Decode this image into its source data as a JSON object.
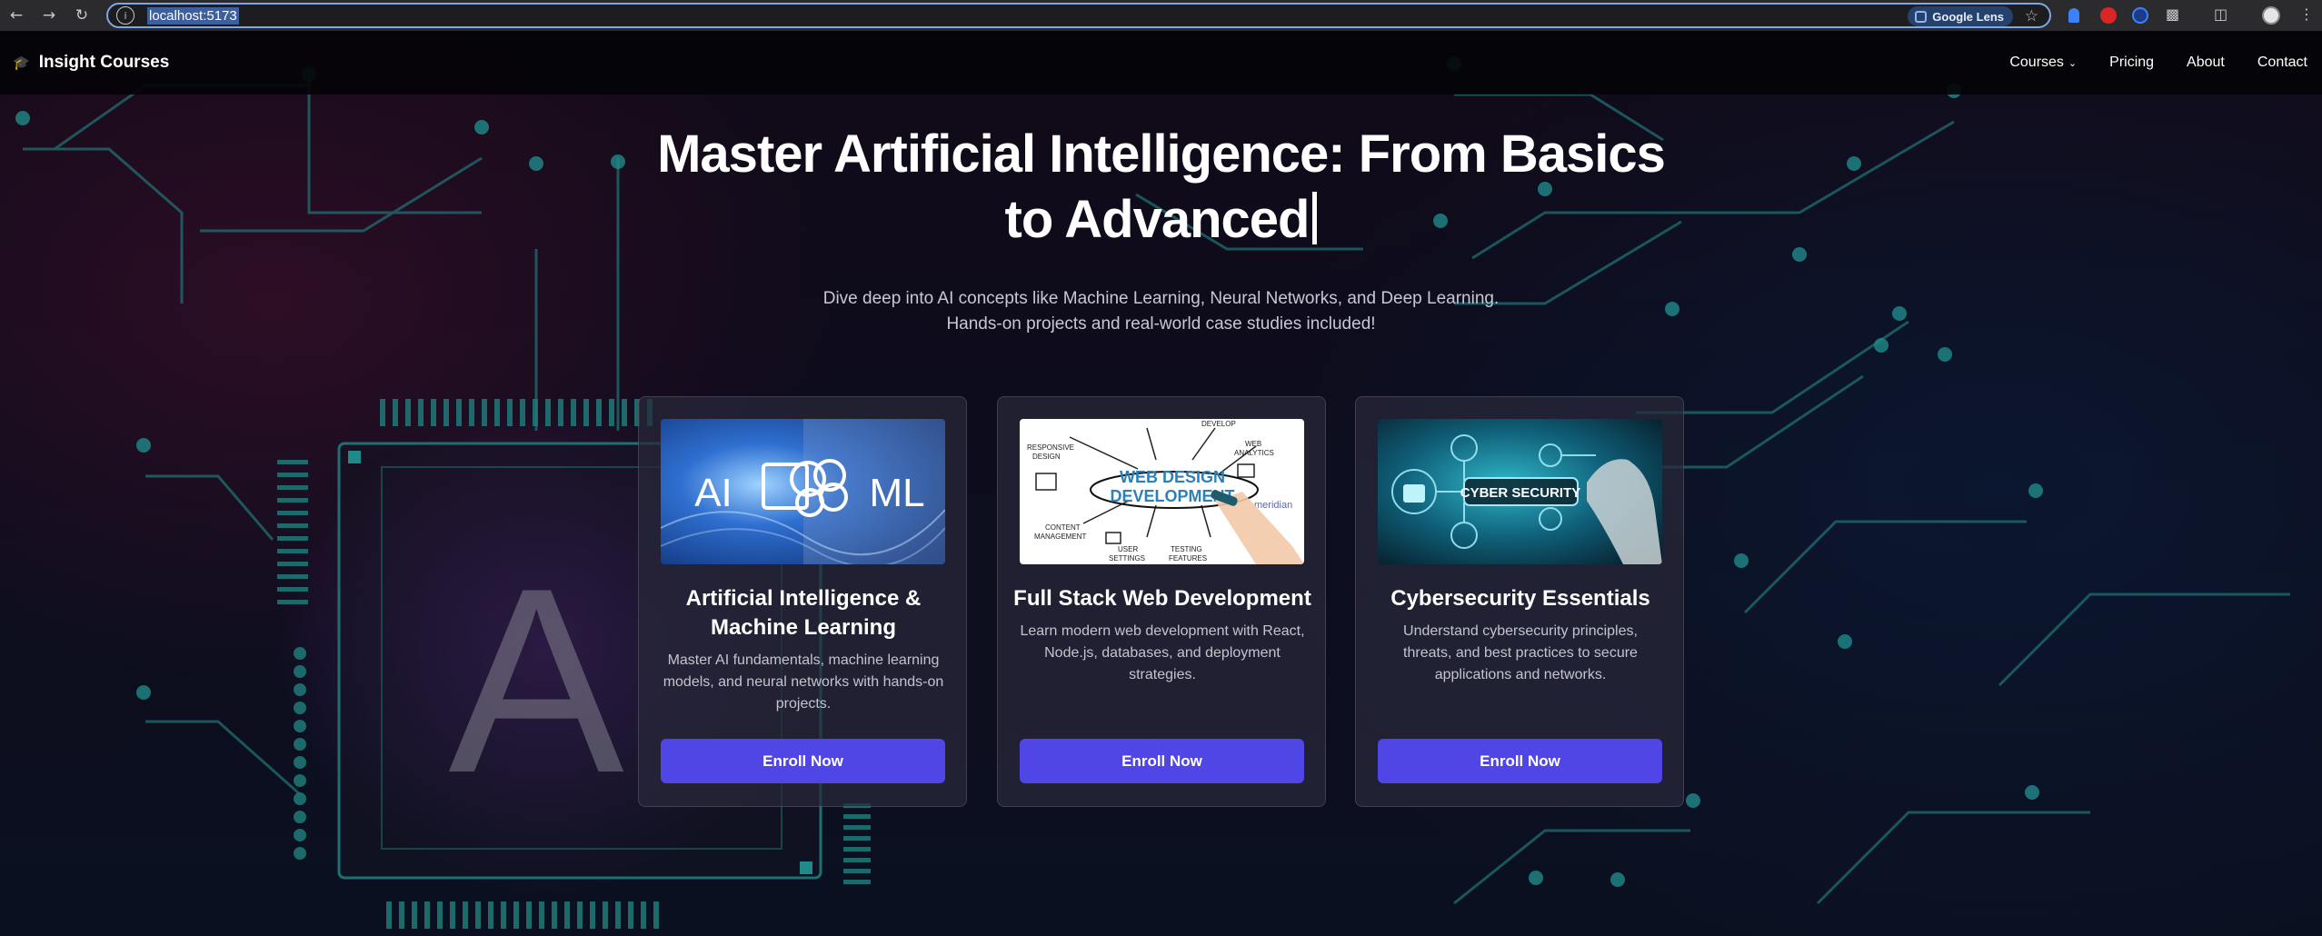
{
  "browser": {
    "url": "localhost:5173",
    "lens_label": "Google Lens"
  },
  "header": {
    "brand": "Insight Courses",
    "nav": {
      "courses": "Courses",
      "pricing": "Pricing",
      "about": "About",
      "contact": "Contact"
    }
  },
  "hero": {
    "title_line1": "Master Artificial Intelligence: From Basics",
    "title_line2": "to Advanced",
    "subtitle_line1": "Dive deep into AI concepts like Machine Learning, Neural Networks, and Deep Learning.",
    "subtitle_line2": "Hands-on projects and real-world case studies included!"
  },
  "background": {
    "big_letter": "A"
  },
  "cards": [
    {
      "title": "Artificial Intelligence & Machine Learning",
      "description": "Master AI fundamentals, machine learning models, and neural networks with hands-on projects.",
      "button": "Enroll Now",
      "image": {
        "left_text": "AI",
        "right_text": "ML"
      }
    },
    {
      "title": "Full Stack Web Development",
      "description": "Learn modern web development with React, Node.js, databases, and deployment strategies.",
      "button": "Enroll Now",
      "image": {
        "heading_line1": "WEB DESIGN",
        "heading_line2": "DEVELOPMENT",
        "labels": [
          "RESPONSIVE",
          "DESIGN",
          "DEVELOP",
          "WEB",
          "ANALYTICS",
          "CONTENT",
          "MANAGEMENT",
          "USER",
          "SETTINGS",
          "TESTING",
          "FEATURES",
          "meridian"
        ]
      }
    },
    {
      "title": "Cybersecurity Essentials",
      "description": "Understand cybersecurity principles, threats, and best practices to secure applications and networks.",
      "button": "Enroll Now",
      "image": {
        "label": "CYBER SECURITY"
      }
    }
  ],
  "colors": {
    "button": "#4f46e5",
    "circuit": "#2aa8a0"
  }
}
